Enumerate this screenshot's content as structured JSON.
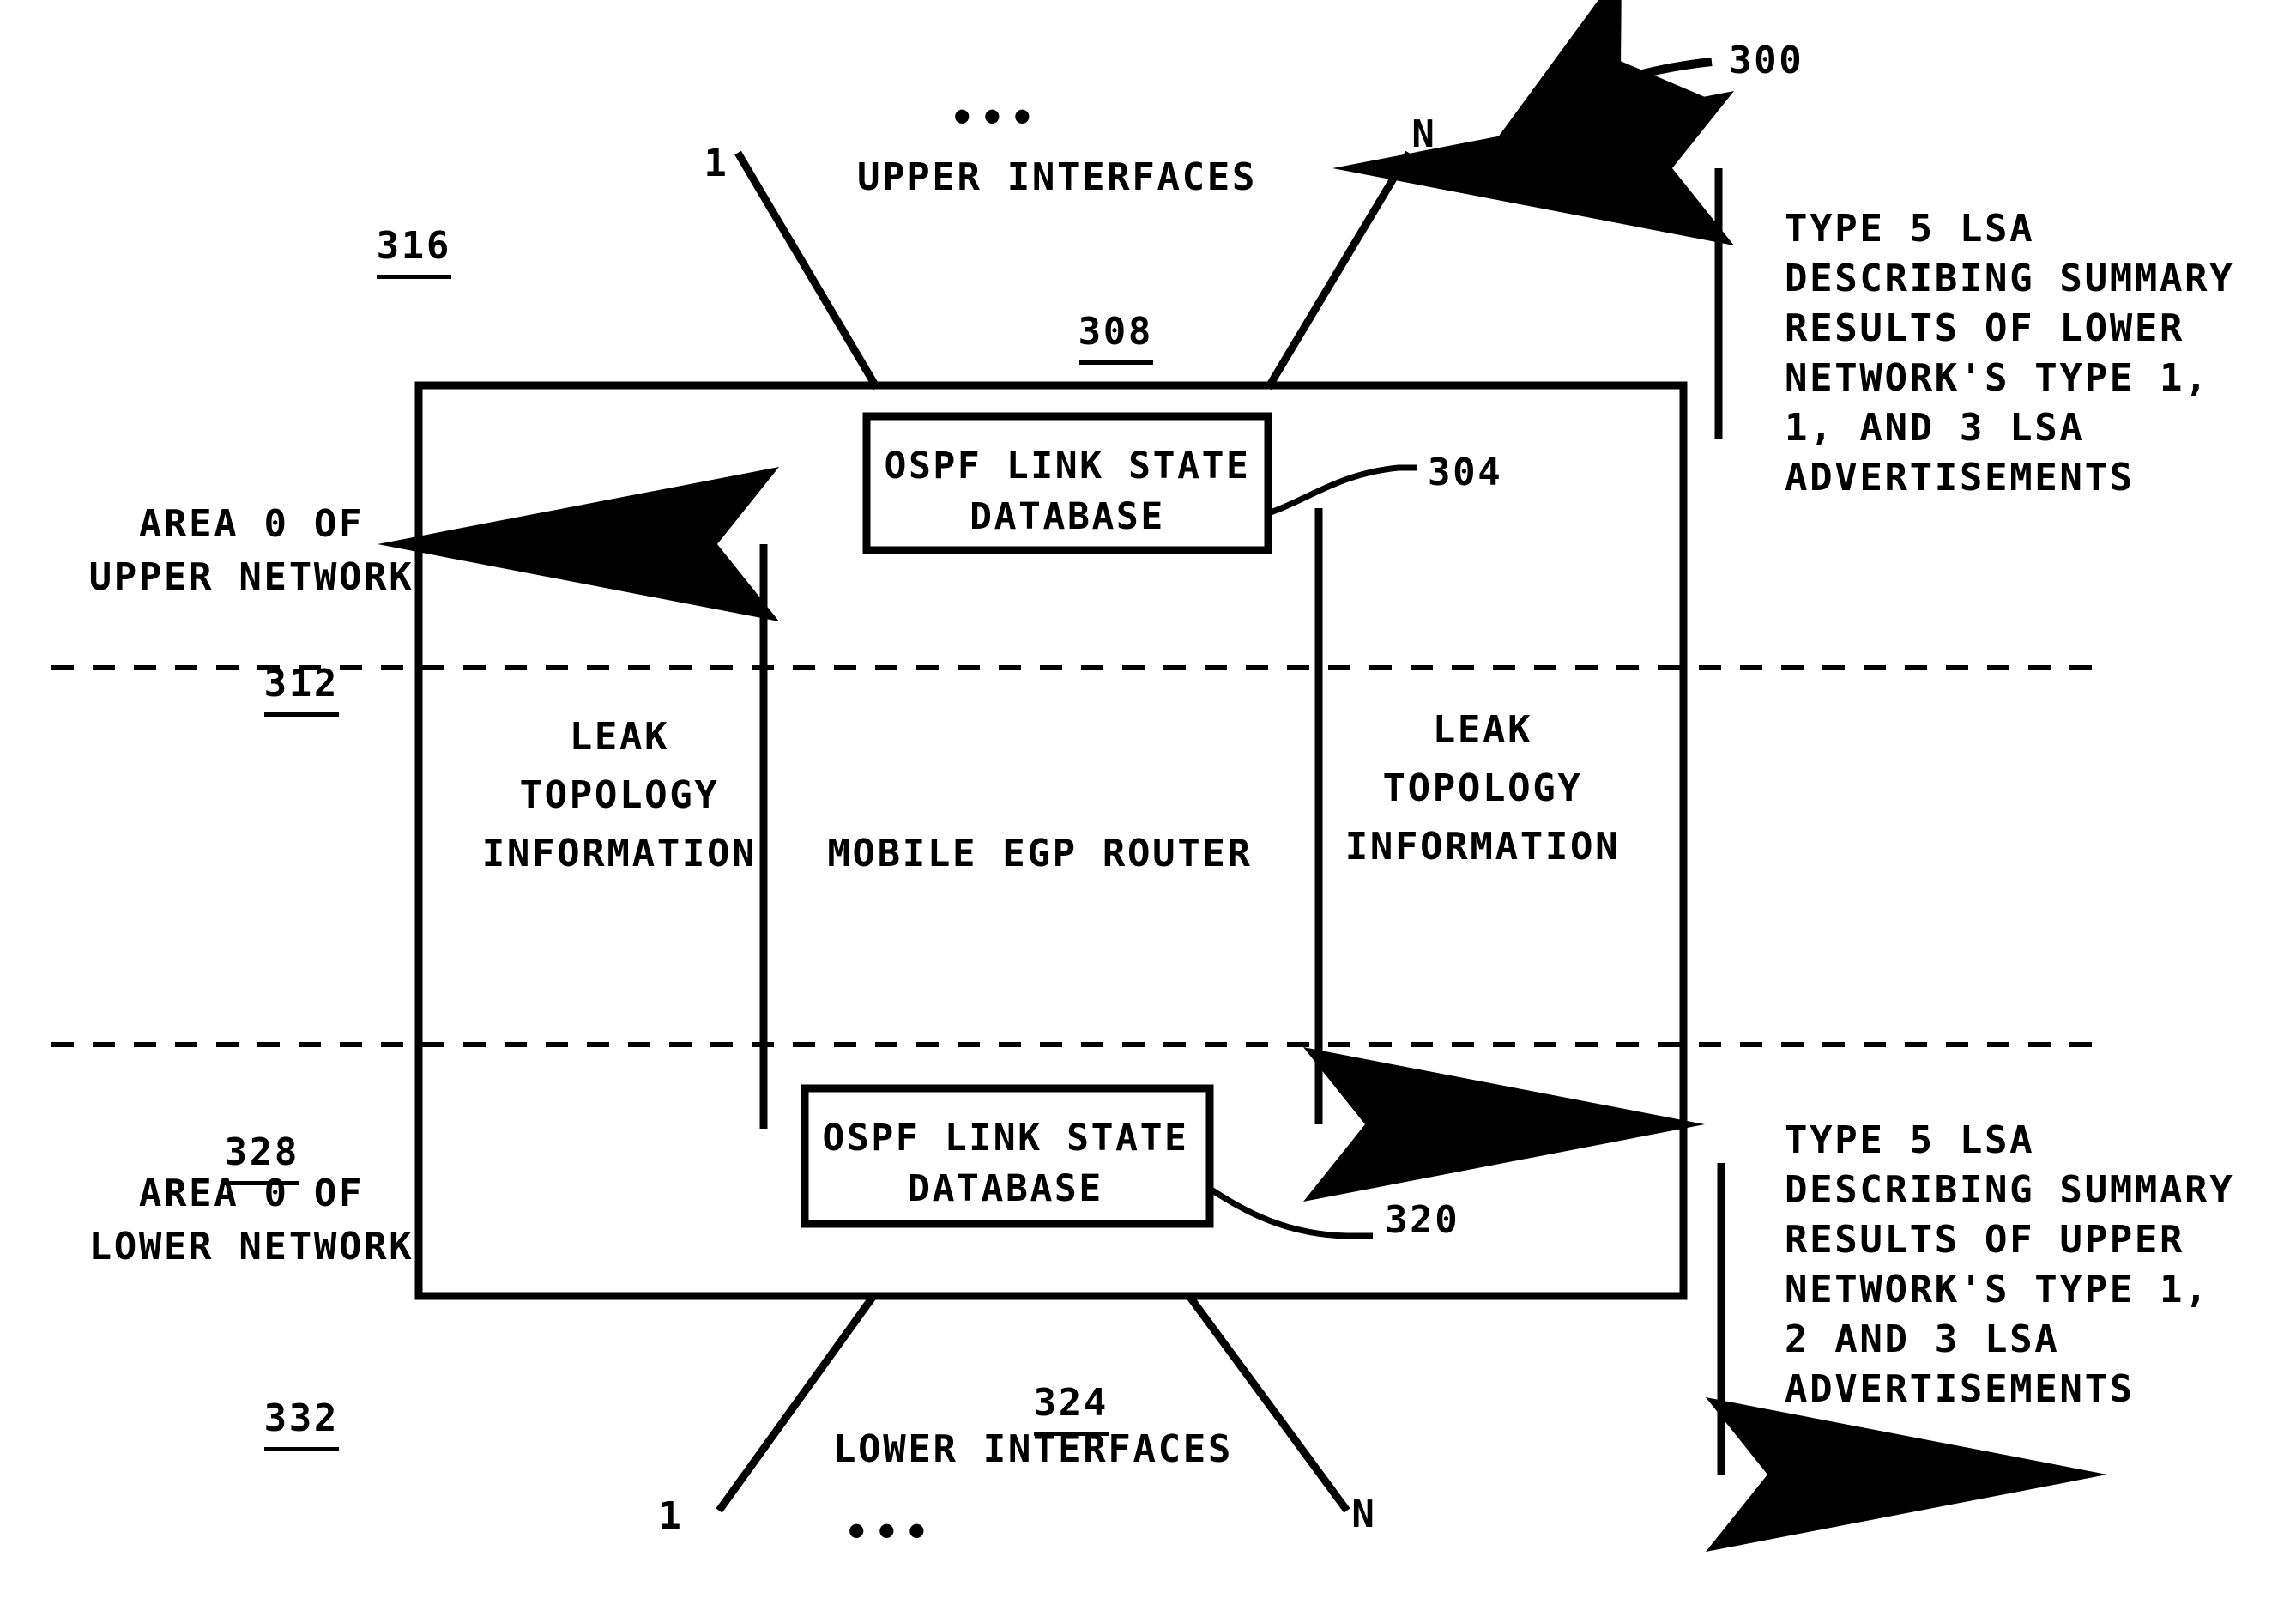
{
  "figure": {
    "id": "300",
    "main_block_label": "MOBILE EGP ROUTER"
  },
  "top": {
    "interfaces_label": "UPPER INTERFACES",
    "interfaces_ref": "308",
    "first_index": "1",
    "last_index": "N",
    "ellipsis": "•••"
  },
  "bottom": {
    "interfaces_label": "LOWER INTERFACES",
    "interfaces_ref": "324",
    "first_index": "1",
    "last_index": "N",
    "ellipsis": "•••"
  },
  "left": {
    "upper_ref": "316",
    "upper_area_line1": "AREA 0 OF",
    "upper_area_line2": "UPPER NETWORK",
    "upper_area_ref": "312",
    "lower_ref": "328",
    "lower_area_line1": "AREA 0 OF",
    "lower_area_line2": "LOWER NETWORK",
    "lower_area_ref": "332"
  },
  "boxes": {
    "upper_db_line1": "OSPF LINK STATE",
    "upper_db_line2": "DATABASE",
    "upper_db_ref": "304",
    "lower_db_line1": "OSPF LINK STATE",
    "lower_db_line2": "DATABASE",
    "lower_db_ref": "320"
  },
  "leak": {
    "left_line1": "LEAK",
    "left_line2": "TOPOLOGY",
    "left_line3": "INFORMATION",
    "right_line1": "LEAK",
    "right_line2": "TOPOLOGY",
    "right_line3": "INFORMATION"
  },
  "annotations": {
    "upper_lsa": "TYPE 5 LSA\nDESCRIBING SUMMARY\nRESULTS OF LOWER\nNETWORK'S TYPE 1,\n1, AND 3 LSA\nADVERTISEMENTS",
    "lower_lsa": "TYPE 5 LSA\nDESCRIBING SUMMARY\nRESULTS OF UPPER\nNETWORK'S TYPE 1,\n2 AND 3 LSA\nADVERTISEMENTS"
  },
  "colors": {
    "ink": "#000000",
    "paper": "#ffffff"
  }
}
